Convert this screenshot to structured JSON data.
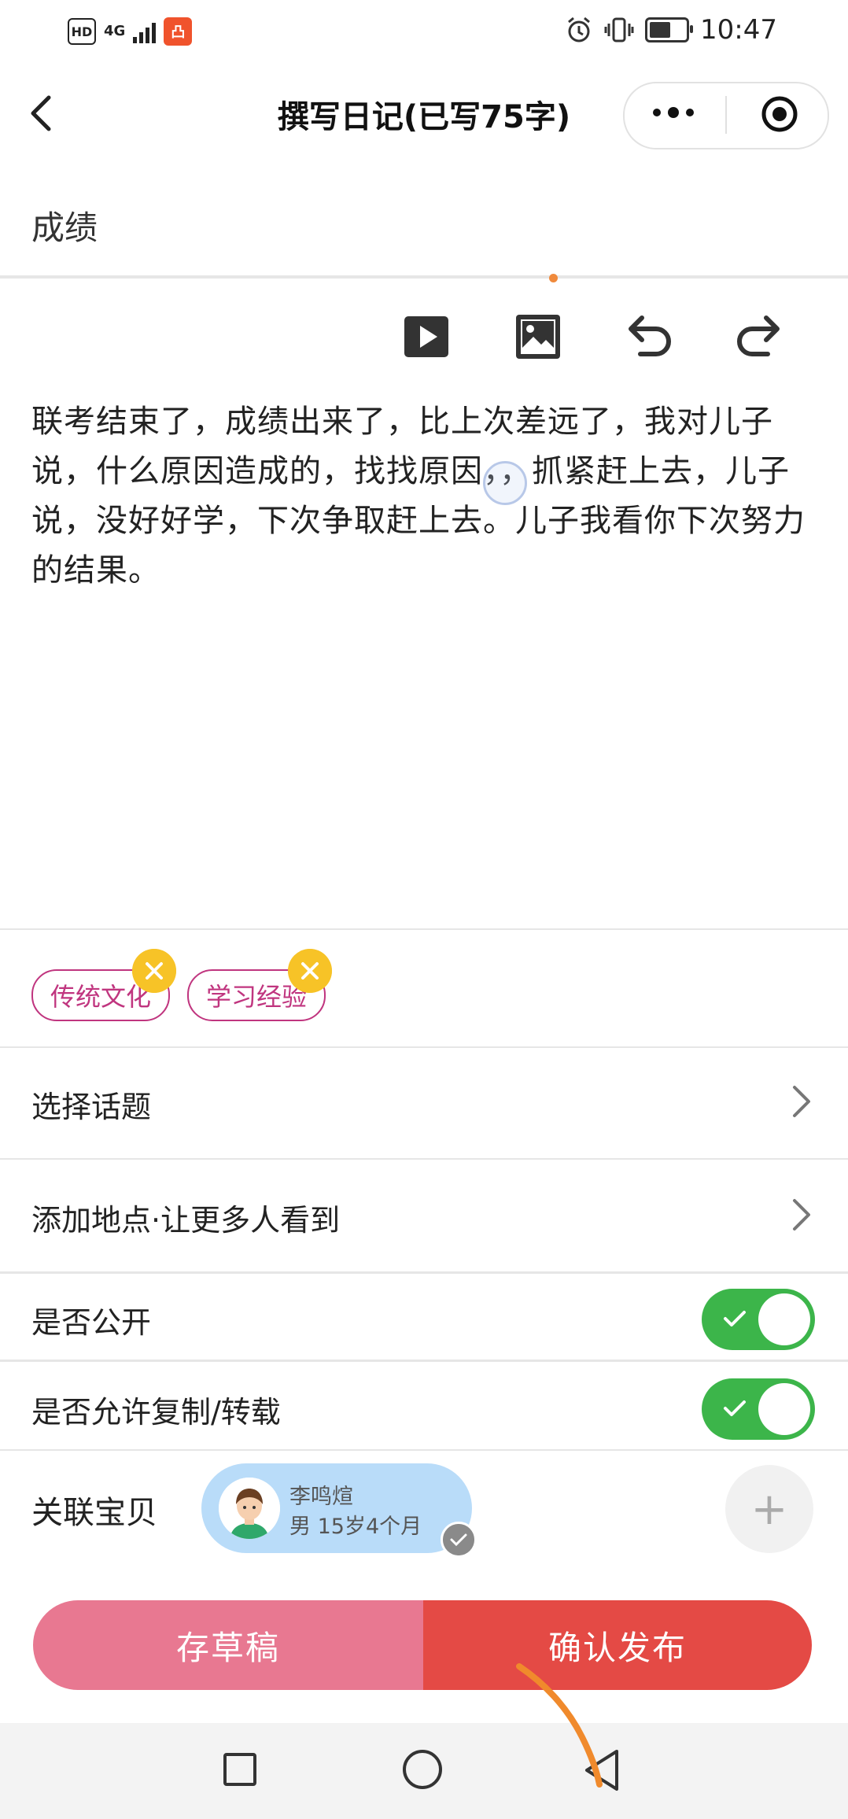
{
  "status_bar": {
    "hd": "HD",
    "network": "4G",
    "app_badge": "凸",
    "time": "10:47",
    "icons": [
      "alarm-icon",
      "vibrate-icon",
      "battery-icon"
    ]
  },
  "header": {
    "title": "撰写日记(已写75字)",
    "back_icon": "chevron-left-icon",
    "more_icon": "more-dots-icon",
    "close_icon": "target-icon"
  },
  "subject": "成绩",
  "toolbar": [
    "video-icon",
    "image-icon",
    "undo-icon",
    "redo-icon"
  ],
  "content": "联考结束了，成绩出来了，比上次差远了，我对儿子说，什么原因造成的，找找原因，，抓紧赶上去，儿子说，没好好学，下次争取赶上去。儿子我看你下次努力的结果。",
  "tags": [
    {
      "label": "传统文化"
    },
    {
      "label": "学习经验"
    }
  ],
  "rows": {
    "topic": "选择话题",
    "location": "添加地点·让更多人看到",
    "public": "是否公开",
    "allow_copy": "是否允许复制/转载",
    "related": "关联宝贝"
  },
  "toggles": {
    "public": true,
    "allow_copy": true
  },
  "child": {
    "name": "李鸣煊",
    "info": "男  15岁4个月"
  },
  "buttons": {
    "draft": "存草稿",
    "publish": "确认发布",
    "add": "+"
  },
  "colors": {
    "tag": "#c0357f",
    "toggle_on": "#3cb54a",
    "draft": "#e87891",
    "publish": "#e44a45",
    "chip": "#b9dcf9"
  }
}
